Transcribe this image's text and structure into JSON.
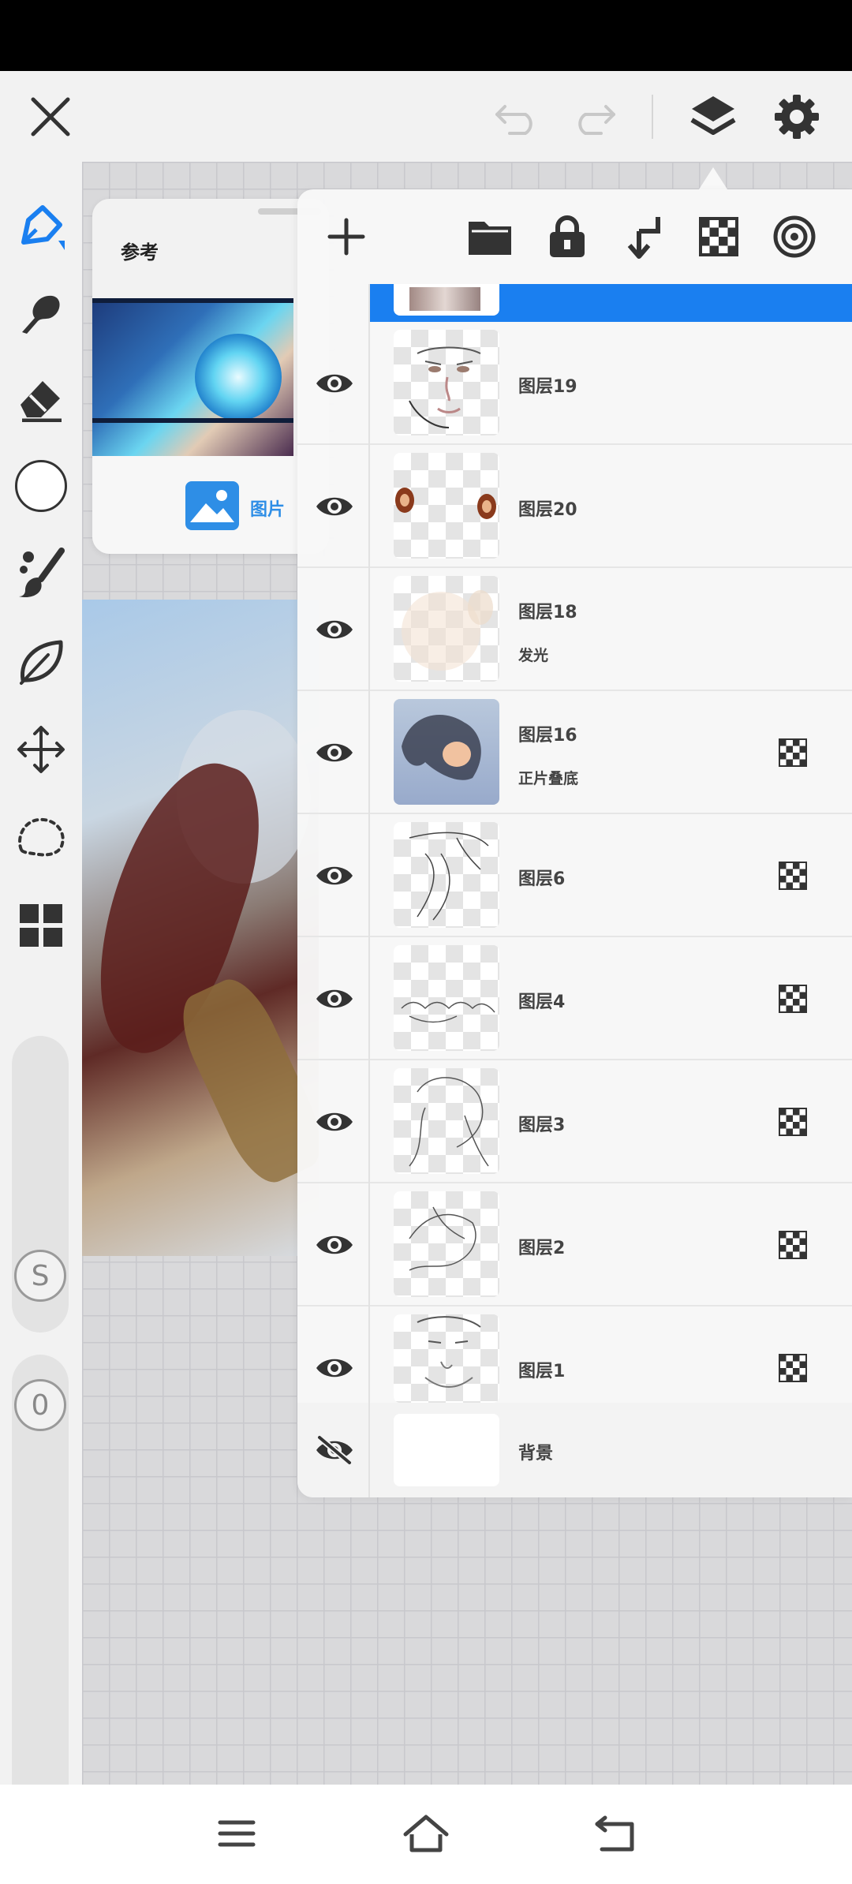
{
  "app": {
    "accent_color": "#1a7ff0",
    "icon_color": "#333333"
  },
  "top_bar": {
    "icons": [
      "close-icon",
      "undo-icon",
      "redo-icon",
      "layers-icon",
      "settings-icon"
    ]
  },
  "left_toolbar": {
    "tools": [
      "pen-tool",
      "smudge-tool",
      "eraser-tool",
      "color-picker",
      "brush-tool",
      "leaf-brush-tool",
      "move-tool",
      "lasso-tool",
      "grid-tool"
    ],
    "size_slider_label": "S",
    "opacity_slider_label": "0"
  },
  "reference_panel": {
    "title": "参考",
    "image_button_label": "图片"
  },
  "layers_panel": {
    "toolbar_icons": [
      "add-layer-icon",
      "folder-icon",
      "lock-icon",
      "merge-down-icon",
      "alpha-lock-icon",
      "clipping-mask-icon"
    ],
    "layers": [
      {
        "name": "图层19",
        "mode": "",
        "visible": true,
        "alpha_locked": false
      },
      {
        "name": "图层20",
        "mode": "",
        "visible": true,
        "alpha_locked": false
      },
      {
        "name": "图层18",
        "mode": "发光",
        "visible": true,
        "alpha_locked": false
      },
      {
        "name": "图层16",
        "mode": "正片叠底",
        "visible": true,
        "alpha_locked": true
      },
      {
        "name": "图层6",
        "mode": "",
        "visible": true,
        "alpha_locked": true
      },
      {
        "name": "图层4",
        "mode": "",
        "visible": true,
        "alpha_locked": true
      },
      {
        "name": "图层3",
        "mode": "",
        "visible": true,
        "alpha_locked": true
      },
      {
        "name": "图层2",
        "mode": "",
        "visible": true,
        "alpha_locked": true
      },
      {
        "name": "图层1",
        "mode": "",
        "visible": true,
        "alpha_locked": true
      }
    ],
    "background": {
      "name": "背景",
      "visible": false
    }
  },
  "nav_bar": {
    "icons": [
      "menu-icon",
      "home-icon",
      "back-icon"
    ]
  }
}
